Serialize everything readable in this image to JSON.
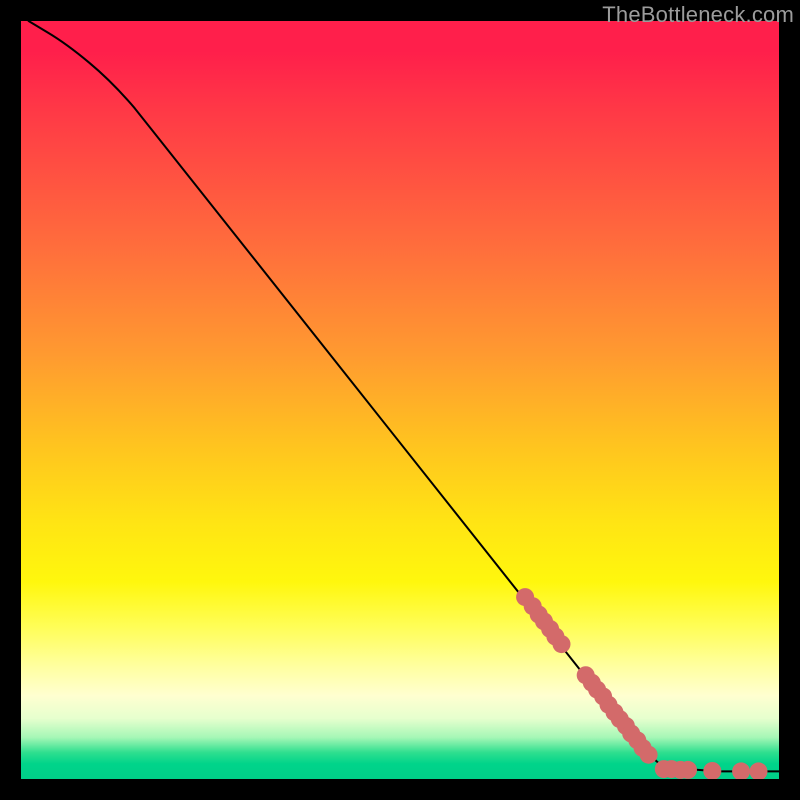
{
  "watermark": "TheBottleneck.com",
  "chart_data": {
    "type": "line",
    "title": "",
    "xlabel": "",
    "ylabel": "",
    "xlim": [
      0,
      100
    ],
    "ylim": [
      0,
      100
    ],
    "curve": [
      {
        "x": 1,
        "y": 100
      },
      {
        "x": 6,
        "y": 97
      },
      {
        "x": 12,
        "y": 92
      },
      {
        "x": 18,
        "y": 85
      },
      {
        "x": 82,
        "y": 4
      },
      {
        "x": 85,
        "y": 1.3
      },
      {
        "x": 88,
        "y": 1.3
      },
      {
        "x": 92,
        "y": 1.0
      },
      {
        "x": 96,
        "y": 1.0
      },
      {
        "x": 100,
        "y": 1.0
      }
    ],
    "markers": [
      {
        "x": 66.5,
        "y": 24.0
      },
      {
        "x": 67.5,
        "y": 22.8
      },
      {
        "x": 68.3,
        "y": 21.7
      },
      {
        "x": 69.0,
        "y": 20.8
      },
      {
        "x": 69.8,
        "y": 19.8
      },
      {
        "x": 70.5,
        "y": 18.8
      },
      {
        "x": 71.3,
        "y": 17.8
      },
      {
        "x": 74.5,
        "y": 13.7
      },
      {
        "x": 75.3,
        "y": 12.7
      },
      {
        "x": 76.0,
        "y": 11.8
      },
      {
        "x": 76.8,
        "y": 10.9
      },
      {
        "x": 77.5,
        "y": 9.8
      },
      {
        "x": 78.3,
        "y": 8.8
      },
      {
        "x": 79.0,
        "y": 7.9
      },
      {
        "x": 79.8,
        "y": 7.0
      },
      {
        "x": 80.5,
        "y": 6.0
      },
      {
        "x": 81.3,
        "y": 5.1
      },
      {
        "x": 82.0,
        "y": 4.1
      },
      {
        "x": 82.8,
        "y": 3.2
      },
      {
        "x": 84.8,
        "y": 1.3
      },
      {
        "x": 85.8,
        "y": 1.3
      },
      {
        "x": 87.0,
        "y": 1.2
      },
      {
        "x": 88.0,
        "y": 1.2
      },
      {
        "x": 91.2,
        "y": 1.05
      },
      {
        "x": 95.0,
        "y": 1.0
      },
      {
        "x": 97.3,
        "y": 1.0
      }
    ],
    "marker_color": "#d36a6a",
    "marker_radius": 9,
    "curve_color": "#000000"
  }
}
